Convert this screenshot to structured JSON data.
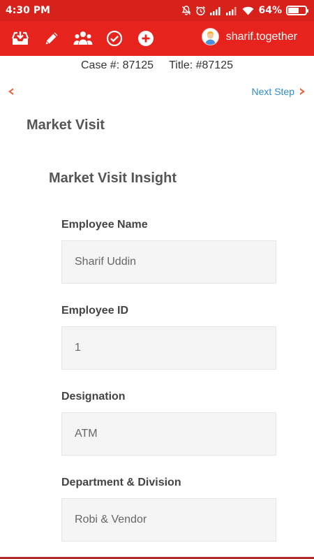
{
  "status_bar": {
    "time": "4:30 PM",
    "battery": "64%",
    "battery_level": 0.64,
    "icons": [
      "mute-icon",
      "alarm-icon",
      "signal-icon",
      "signal-icon",
      "wifi-icon",
      "battery-icon"
    ]
  },
  "toolbar": {
    "icons": [
      "inbox-download-icon",
      "pencil-icon",
      "group-icon",
      "check-circle-icon",
      "plus-circle-icon"
    ],
    "username": "sharif.together"
  },
  "case": {
    "number": "Case #: 87125",
    "title": "Title: #87125"
  },
  "nav": {
    "next_label": "Next Step"
  },
  "page": {
    "section_title": "Market Visit",
    "subsection_title": "Market Visit Insight"
  },
  "fields": [
    {
      "label": "Employee Name",
      "value": "Sharif Uddin"
    },
    {
      "label": "Employee ID",
      "value": "1"
    },
    {
      "label": "Designation",
      "value": "ATM"
    },
    {
      "label": "Department & Division",
      "value": "Robi & Vendor"
    }
  ],
  "colors": {
    "status_bar": "#d7211b",
    "toolbar": "#e6241d",
    "link": "#2e8ccc",
    "arrow": "#e8613a"
  }
}
